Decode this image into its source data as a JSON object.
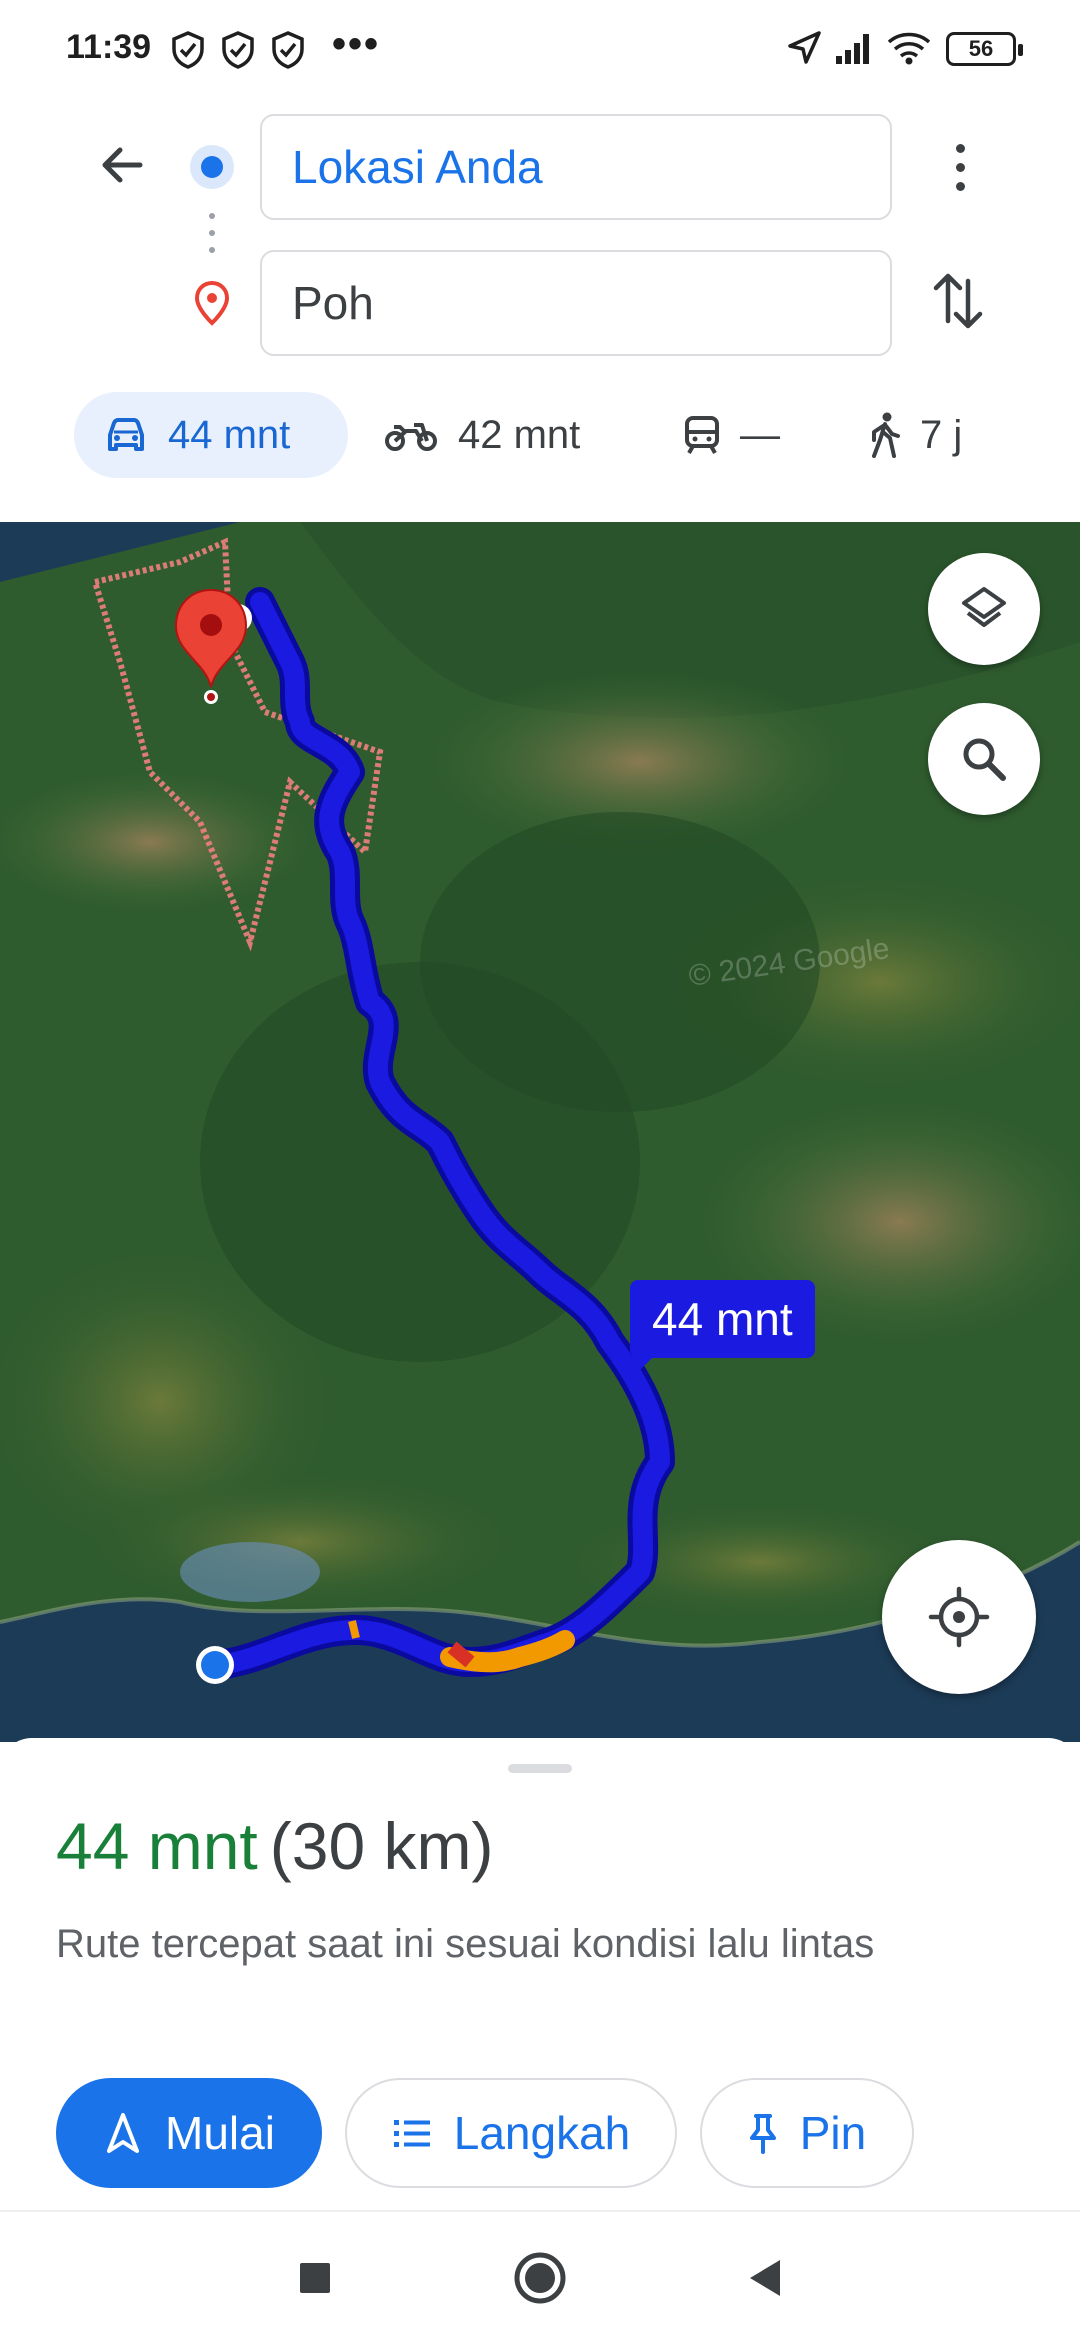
{
  "status_bar": {
    "time": "11:39",
    "battery": "56",
    "icons": [
      "shield-icon",
      "shield-icon",
      "shield-icon",
      "more-notifications-icon",
      "location-arrow-icon",
      "signal-icon",
      "wifi-icon",
      "battery-icon"
    ]
  },
  "directions": {
    "origin": "Lokasi Anda",
    "destination": "Poh"
  },
  "modes": [
    {
      "name": "car",
      "icon": "car-icon",
      "label": "44 mnt",
      "selected": true
    },
    {
      "name": "motorcycle",
      "icon": "motorcycle-icon",
      "label": "42 mnt",
      "selected": false
    },
    {
      "name": "transit",
      "icon": "train-icon",
      "label": "—",
      "selected": false
    },
    {
      "name": "walk",
      "icon": "walk-icon",
      "label": "7 j",
      "selected": false
    }
  ],
  "map": {
    "route_time_label": "44 mnt",
    "watermark": "© 2024 Google",
    "route_color": "#1a1ae0"
  },
  "sheet": {
    "time": "44 mnt",
    "distance": "(30 km)",
    "description": "Rute tercepat saat ini sesuai kondisi lalu lintas",
    "start_label": "Mulai",
    "steps_label": "Langkah",
    "pin_label": "Pin"
  },
  "colors": {
    "accent": "#1a73e8",
    "eta_green": "#188038",
    "pin_red": "#ea4335"
  }
}
